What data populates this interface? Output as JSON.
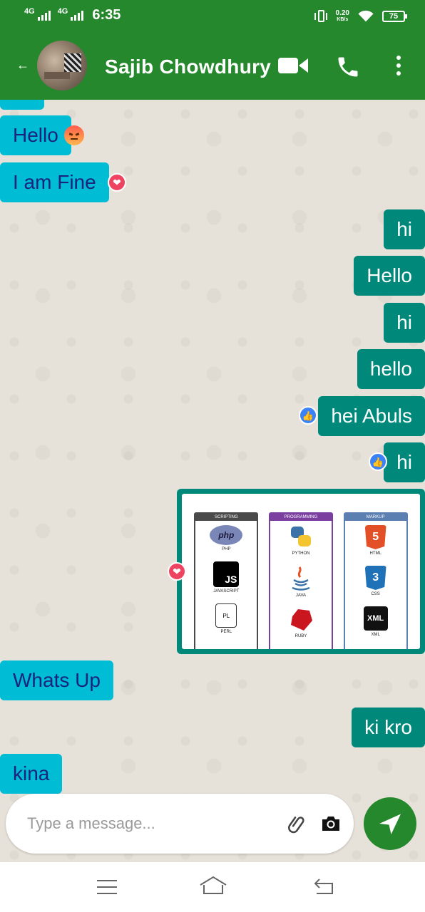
{
  "status_bar": {
    "network1": "4G",
    "network2": "4G",
    "time": "6:35",
    "speed_value": "0.20",
    "speed_unit": "KB/s",
    "battery": "75"
  },
  "header": {
    "contact_name": "Sajib Chowdhury",
    "back_icon": "back-arrow-icon",
    "video_icon": "video-call-icon",
    "phone_icon": "phone-icon",
    "menu_icon": "more-vert-icon"
  },
  "messages": [
    {
      "dir": "in",
      "text": "Hello",
      "reaction": "angry"
    },
    {
      "dir": "in",
      "text": "I am  Fine",
      "reaction": "love"
    },
    {
      "dir": "out",
      "text": "hi",
      "reaction": null
    },
    {
      "dir": "out",
      "text": "Hello",
      "reaction": null
    },
    {
      "dir": "out",
      "text": "hi",
      "reaction": null
    },
    {
      "dir": "out",
      "text": "hello",
      "reaction": null
    },
    {
      "dir": "out",
      "text": "hei Abuls",
      "reaction": "like"
    },
    {
      "dir": "out",
      "text": "hi",
      "reaction": "like"
    },
    {
      "dir": "out",
      "type": "image",
      "reaction": "love"
    },
    {
      "dir": "in",
      "text": "Whats Up",
      "reaction": null
    },
    {
      "dir": "out",
      "text": "ki kro",
      "reaction": null
    },
    {
      "dir": "in",
      "text": "kina",
      "reaction": null
    }
  ],
  "image_card": {
    "columns": [
      {
        "header": "SCRIPTING",
        "color": "#4a4a4a",
        "items": [
          {
            "logo": "php",
            "caption": "PHP"
          },
          {
            "logo": "JS",
            "caption": "JAVASCRIPT"
          },
          {
            "logo": "PL",
            "caption": "PERL"
          }
        ]
      },
      {
        "header": "PROGRAMMING",
        "color": "#7b3fa0",
        "items": [
          {
            "logo": "",
            "caption": "PYTHON"
          },
          {
            "logo": "",
            "caption": "JAVA"
          },
          {
            "logo": "",
            "caption": "RUBY"
          }
        ]
      },
      {
        "header": "MARKUP",
        "color": "#5b7fb0",
        "items": [
          {
            "logo": "5",
            "caption": "HTML"
          },
          {
            "logo": "3",
            "caption": "CSS"
          },
          {
            "logo": "XML",
            "caption": "XML"
          }
        ]
      }
    ]
  },
  "input": {
    "placeholder": "Type a message...",
    "attach_icon": "paperclip-icon",
    "camera_icon": "camera-icon",
    "send_icon": "send-icon"
  },
  "nav": {
    "menu_icon": "menu-icon",
    "home_icon": "home-icon",
    "back_icon": "back-icon"
  },
  "colors": {
    "primary": "#25882c",
    "incoming_bubble": "#00bcd4",
    "incoming_text": "#1a237e",
    "outgoing_bubble": "#00897b",
    "outgoing_text": "#ffffff"
  }
}
